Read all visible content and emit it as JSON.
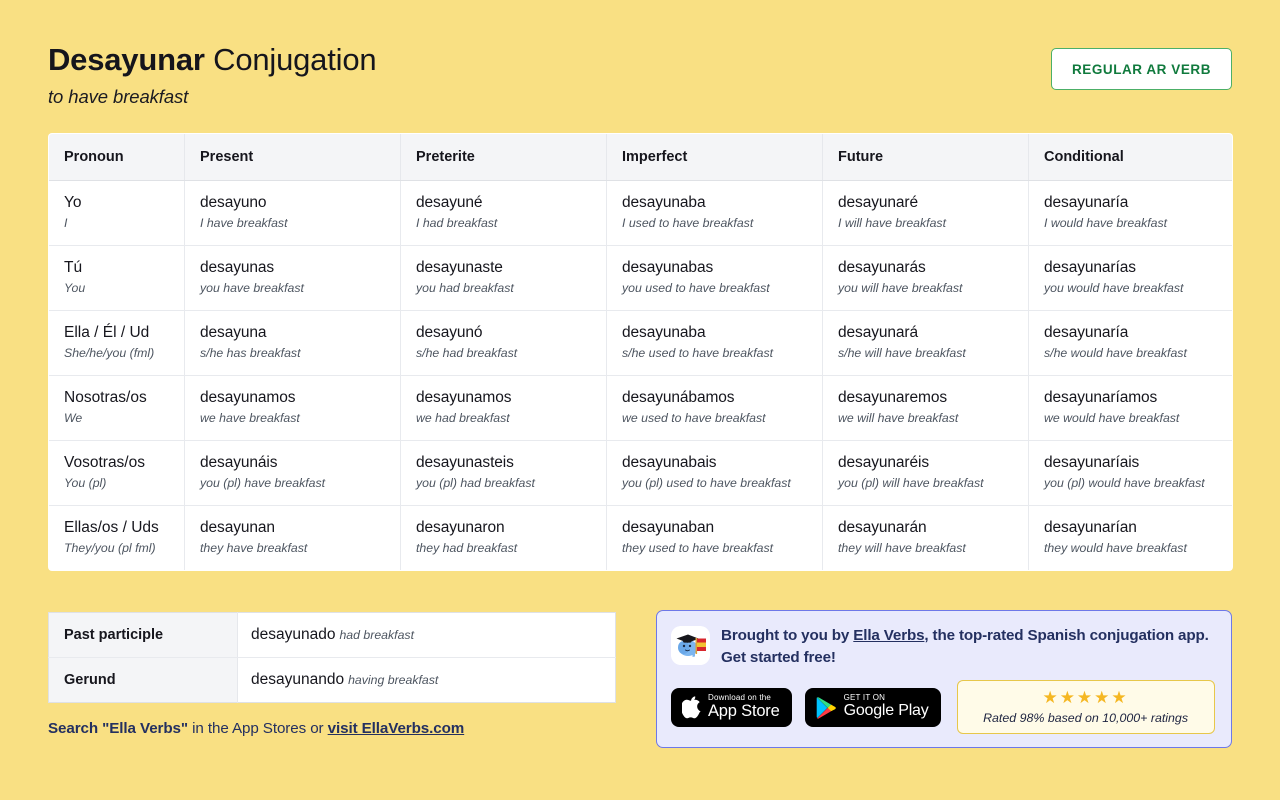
{
  "header": {
    "verb": "Desayunar",
    "title_suffix": " Conjugation",
    "translation": "to have breakfast",
    "badge": "REGULAR AR VERB"
  },
  "table": {
    "columns": [
      "Pronoun",
      "Present",
      "Preterite",
      "Imperfect",
      "Future",
      "Conditional"
    ],
    "rows": [
      {
        "pronoun": "Yo",
        "pronoun_gloss": "I",
        "cells": [
          {
            "form": "desayuno",
            "gloss": "I have breakfast"
          },
          {
            "form": "desayuné",
            "gloss": "I had breakfast"
          },
          {
            "form": "desayunaba",
            "gloss": "I used to have breakfast"
          },
          {
            "form": "desayunaré",
            "gloss": "I will have breakfast"
          },
          {
            "form": "desayunaría",
            "gloss": "I would have breakfast"
          }
        ]
      },
      {
        "pronoun": "Tú",
        "pronoun_gloss": "You",
        "cells": [
          {
            "form": "desayunas",
            "gloss": "you have breakfast"
          },
          {
            "form": "desayunaste",
            "gloss": "you had breakfast"
          },
          {
            "form": "desayunabas",
            "gloss": "you used to have breakfast"
          },
          {
            "form": "desayunarás",
            "gloss": "you will have breakfast"
          },
          {
            "form": "desayunarías",
            "gloss": "you would have breakfast"
          }
        ]
      },
      {
        "pronoun": "Ella / Él / Ud",
        "pronoun_gloss": "She/he/you (fml)",
        "cells": [
          {
            "form": "desayuna",
            "gloss": "s/he has breakfast"
          },
          {
            "form": "desayunó",
            "gloss": "s/he had breakfast"
          },
          {
            "form": "desayunaba",
            "gloss": "s/he used to have breakfast"
          },
          {
            "form": "desayunará",
            "gloss": "s/he will have breakfast"
          },
          {
            "form": "desayunaría",
            "gloss": "s/he would have breakfast"
          }
        ]
      },
      {
        "pronoun": "Nosotras/os",
        "pronoun_gloss": "We",
        "cells": [
          {
            "form": "desayunamos",
            "gloss": "we have breakfast"
          },
          {
            "form": "desayunamos",
            "gloss": "we had breakfast"
          },
          {
            "form": "desayunábamos",
            "gloss": "we used to have breakfast"
          },
          {
            "form": "desayunaremos",
            "gloss": "we will have breakfast"
          },
          {
            "form": "desayunaríamos",
            "gloss": "we would have breakfast"
          }
        ]
      },
      {
        "pronoun": "Vosotras/os",
        "pronoun_gloss": "You (pl)",
        "cells": [
          {
            "form": "desayunáis",
            "gloss": "you (pl) have breakfast"
          },
          {
            "form": "desayunasteis",
            "gloss": "you (pl) had breakfast"
          },
          {
            "form": "desayunabais",
            "gloss": "you (pl) used to have breakfast"
          },
          {
            "form": "desayunaréis",
            "gloss": "you (pl) will have breakfast"
          },
          {
            "form": "desayunaríais",
            "gloss": "you (pl) would have breakfast"
          }
        ]
      },
      {
        "pronoun": "Ellas/os / Uds",
        "pronoun_gloss": "They/you (pl fml)",
        "cells": [
          {
            "form": "desayunan",
            "gloss": "they have breakfast"
          },
          {
            "form": "desayunaron",
            "gloss": "they had breakfast"
          },
          {
            "form": "desayunaban",
            "gloss": "they used to have breakfast"
          },
          {
            "form": "desayunarán",
            "gloss": "they will have breakfast"
          },
          {
            "form": "desayunarían",
            "gloss": "they would have breakfast"
          }
        ]
      }
    ]
  },
  "nonfinite": {
    "rows": [
      {
        "label": "Past participle",
        "form": "desayunado",
        "gloss": "had breakfast"
      },
      {
        "label": "Gerund",
        "form": "desayunando",
        "gloss": "having breakfast"
      }
    ]
  },
  "footer": {
    "search_bold": "Search \"Ella Verbs\"",
    "search_mid": " in the App Stores or ",
    "search_link": "visit EllaVerbs.com"
  },
  "promo": {
    "text_before": "Brought to you by ",
    "link": "Ella Verbs",
    "text_after": ", the top-rated Spanish conjugation app. Get started free!",
    "app_store": {
      "small": "Download on the",
      "big": "App Store"
    },
    "google_play": {
      "small": "GET IT ON",
      "big": "Google Play"
    },
    "rating": {
      "stars": "★★★★★",
      "text": "Rated 98% based on 10,000+ ratings"
    }
  },
  "colors": {
    "background": "#f9e083",
    "badge_green": "#107a3d",
    "promo_border": "#6e78e8",
    "promo_bg": "#e9eafc",
    "star_gold": "#f5b722",
    "navy": "#243060"
  }
}
